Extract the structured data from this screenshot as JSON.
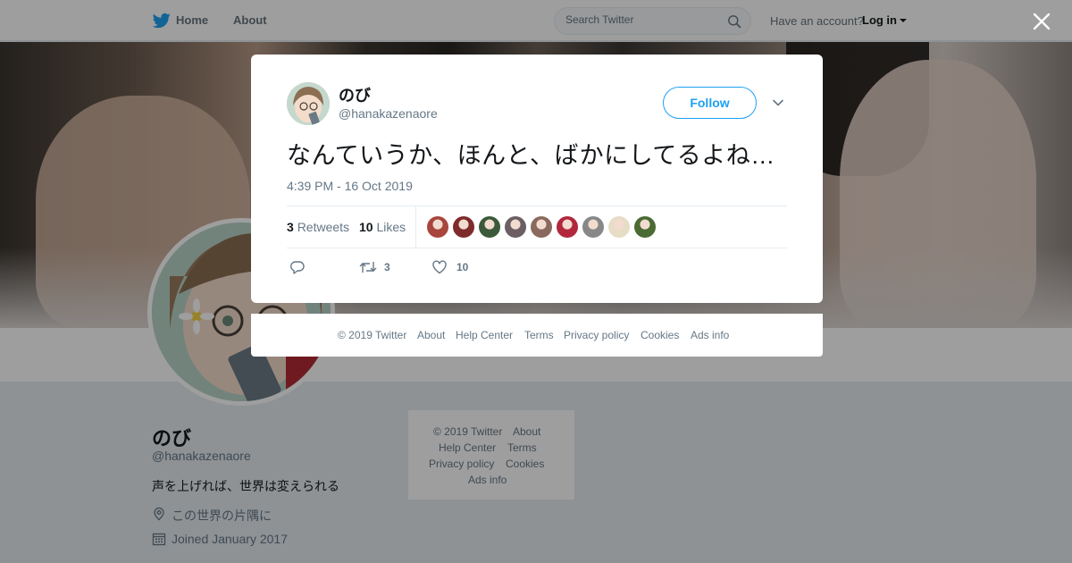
{
  "nav": {
    "home_label": "Home",
    "about_label": "About",
    "search_placeholder": "Search Twitter",
    "have_account": "Have an account?",
    "login_label": "Log in",
    "brand_color": "#1da1f2"
  },
  "profile": {
    "name": "のび",
    "handle": "@hanakazenaore",
    "bio": "声を上げれば、世界は変えられる",
    "location": "この世界の片隅に",
    "joined": "Joined January 2017"
  },
  "side_footer": {
    "copyright": "© 2019 Twitter",
    "about": "About",
    "help_center": "Help Center",
    "terms": "Terms",
    "privacy": "Privacy policy",
    "cookies": "Cookies",
    "ads_info": "Ads info"
  },
  "tweet": {
    "author_name": "のび",
    "author_handle": "@hanakazenaore",
    "follow_label": "Follow",
    "text": "なんていうか、ほんと、ばかにしてるよね…",
    "timestamp": "4:39 PM - 16 Oct 2019",
    "retweets_count": "3",
    "retweets_label": "Retweets",
    "likes_count": "10",
    "likes_label": "Likes",
    "likers": [
      {
        "color": "#a8453d"
      },
      {
        "color": "#7e2b2b"
      },
      {
        "color": "#3b5a3a"
      },
      {
        "color": "#6b5f63"
      },
      {
        "color": "#8a6a5e"
      },
      {
        "color": "#b2273c"
      },
      {
        "color": "#888888"
      },
      {
        "color": "#e7dcc6"
      },
      {
        "color": "#4a6b33"
      }
    ],
    "actions": {
      "reply_icon": "reply-icon",
      "retweet_icon": "retweet-icon",
      "retweet_count": "3",
      "like_icon": "heart-icon",
      "like_count": "10"
    }
  },
  "modal_footer": {
    "copyright": "© 2019 Twitter",
    "about": "About",
    "help_center": "Help Center",
    "terms": "Terms",
    "privacy": "Privacy policy",
    "cookies": "Cookies",
    "ads_info": "Ads info"
  }
}
